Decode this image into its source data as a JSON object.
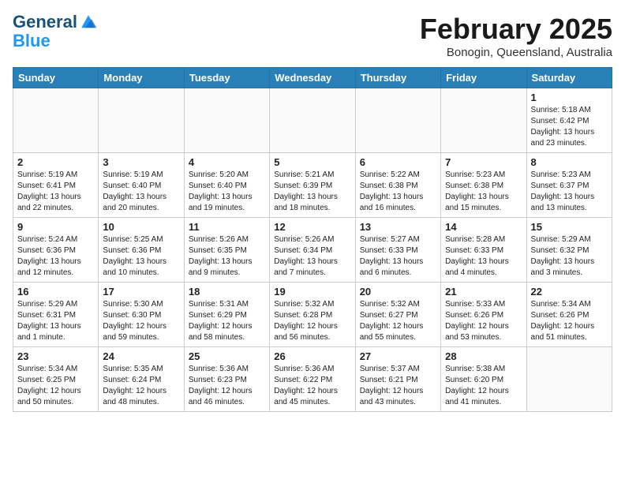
{
  "logo": {
    "line1": "General",
    "line2": "Blue"
  },
  "title": "February 2025",
  "location": "Bonogin, Queensland, Australia",
  "weekdays": [
    "Sunday",
    "Monday",
    "Tuesday",
    "Wednesday",
    "Thursday",
    "Friday",
    "Saturday"
  ],
  "weeks": [
    [
      {
        "day": "",
        "info": ""
      },
      {
        "day": "",
        "info": ""
      },
      {
        "day": "",
        "info": ""
      },
      {
        "day": "",
        "info": ""
      },
      {
        "day": "",
        "info": ""
      },
      {
        "day": "",
        "info": ""
      },
      {
        "day": "1",
        "info": "Sunrise: 5:18 AM\nSunset: 6:42 PM\nDaylight: 13 hours and 23 minutes."
      }
    ],
    [
      {
        "day": "2",
        "info": "Sunrise: 5:19 AM\nSunset: 6:41 PM\nDaylight: 13 hours and 22 minutes."
      },
      {
        "day": "3",
        "info": "Sunrise: 5:19 AM\nSunset: 6:40 PM\nDaylight: 13 hours and 20 minutes."
      },
      {
        "day": "4",
        "info": "Sunrise: 5:20 AM\nSunset: 6:40 PM\nDaylight: 13 hours and 19 minutes."
      },
      {
        "day": "5",
        "info": "Sunrise: 5:21 AM\nSunset: 6:39 PM\nDaylight: 13 hours and 18 minutes."
      },
      {
        "day": "6",
        "info": "Sunrise: 5:22 AM\nSunset: 6:38 PM\nDaylight: 13 hours and 16 minutes."
      },
      {
        "day": "7",
        "info": "Sunrise: 5:23 AM\nSunset: 6:38 PM\nDaylight: 13 hours and 15 minutes."
      },
      {
        "day": "8",
        "info": "Sunrise: 5:23 AM\nSunset: 6:37 PM\nDaylight: 13 hours and 13 minutes."
      }
    ],
    [
      {
        "day": "9",
        "info": "Sunrise: 5:24 AM\nSunset: 6:36 PM\nDaylight: 13 hours and 12 minutes."
      },
      {
        "day": "10",
        "info": "Sunrise: 5:25 AM\nSunset: 6:36 PM\nDaylight: 13 hours and 10 minutes."
      },
      {
        "day": "11",
        "info": "Sunrise: 5:26 AM\nSunset: 6:35 PM\nDaylight: 13 hours and 9 minutes."
      },
      {
        "day": "12",
        "info": "Sunrise: 5:26 AM\nSunset: 6:34 PM\nDaylight: 13 hours and 7 minutes."
      },
      {
        "day": "13",
        "info": "Sunrise: 5:27 AM\nSunset: 6:33 PM\nDaylight: 13 hours and 6 minutes."
      },
      {
        "day": "14",
        "info": "Sunrise: 5:28 AM\nSunset: 6:33 PM\nDaylight: 13 hours and 4 minutes."
      },
      {
        "day": "15",
        "info": "Sunrise: 5:29 AM\nSunset: 6:32 PM\nDaylight: 13 hours and 3 minutes."
      }
    ],
    [
      {
        "day": "16",
        "info": "Sunrise: 5:29 AM\nSunset: 6:31 PM\nDaylight: 13 hours and 1 minute."
      },
      {
        "day": "17",
        "info": "Sunrise: 5:30 AM\nSunset: 6:30 PM\nDaylight: 12 hours and 59 minutes."
      },
      {
        "day": "18",
        "info": "Sunrise: 5:31 AM\nSunset: 6:29 PM\nDaylight: 12 hours and 58 minutes."
      },
      {
        "day": "19",
        "info": "Sunrise: 5:32 AM\nSunset: 6:28 PM\nDaylight: 12 hours and 56 minutes."
      },
      {
        "day": "20",
        "info": "Sunrise: 5:32 AM\nSunset: 6:27 PM\nDaylight: 12 hours and 55 minutes."
      },
      {
        "day": "21",
        "info": "Sunrise: 5:33 AM\nSunset: 6:26 PM\nDaylight: 12 hours and 53 minutes."
      },
      {
        "day": "22",
        "info": "Sunrise: 5:34 AM\nSunset: 6:26 PM\nDaylight: 12 hours and 51 minutes."
      }
    ],
    [
      {
        "day": "23",
        "info": "Sunrise: 5:34 AM\nSunset: 6:25 PM\nDaylight: 12 hours and 50 minutes."
      },
      {
        "day": "24",
        "info": "Sunrise: 5:35 AM\nSunset: 6:24 PM\nDaylight: 12 hours and 48 minutes."
      },
      {
        "day": "25",
        "info": "Sunrise: 5:36 AM\nSunset: 6:23 PM\nDaylight: 12 hours and 46 minutes."
      },
      {
        "day": "26",
        "info": "Sunrise: 5:36 AM\nSunset: 6:22 PM\nDaylight: 12 hours and 45 minutes."
      },
      {
        "day": "27",
        "info": "Sunrise: 5:37 AM\nSunset: 6:21 PM\nDaylight: 12 hours and 43 minutes."
      },
      {
        "day": "28",
        "info": "Sunrise: 5:38 AM\nSunset: 6:20 PM\nDaylight: 12 hours and 41 minutes."
      },
      {
        "day": "",
        "info": ""
      }
    ]
  ]
}
